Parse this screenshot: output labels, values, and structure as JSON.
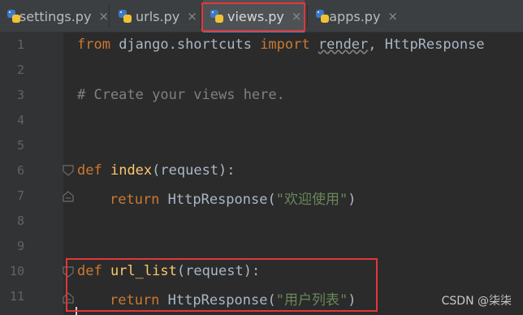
{
  "tabs": [
    {
      "label": "settings.py",
      "close": "×"
    },
    {
      "label": "urls.py",
      "close": "×"
    },
    {
      "label": "views.py",
      "close": "×"
    },
    {
      "label": "apps.py",
      "close": "×"
    }
  ],
  "active_tab": "views.py",
  "line_numbers": [
    "1",
    "2",
    "3",
    "4",
    "5",
    "6",
    "7",
    "8",
    "9",
    "10",
    "11"
  ],
  "code": {
    "l1_from": "from",
    "l1_mod": " django.shortcuts ",
    "l1_import": "import",
    "l1_render": "render",
    "l1_rest": ", HttpResponse",
    "l3_comment": "# Create your views here.",
    "l6_def": "def",
    "l6_name": "index",
    "l6_args": "(request):",
    "l7_return": "return",
    "l7_call": " HttpResponse(",
    "l7_str": "\"欢迎使用\"",
    "l7_end": ")",
    "l10_def": "def",
    "l10_name": "url_list",
    "l10_args": "(request):",
    "l11_return": "return",
    "l11_call": " HttpResponse(",
    "l11_str": "\"用户列表\"",
    "l11_end": ")"
  },
  "watermark": "CSDN @柒柒",
  "colors": {
    "editor_bg": "#2b2b2b",
    "keyword": "#cc7832",
    "function": "#ffc66d",
    "string": "#6a8759",
    "comment": "#808080",
    "highlight": "#e0373a",
    "active_tab_underline": "#4a88c7"
  }
}
